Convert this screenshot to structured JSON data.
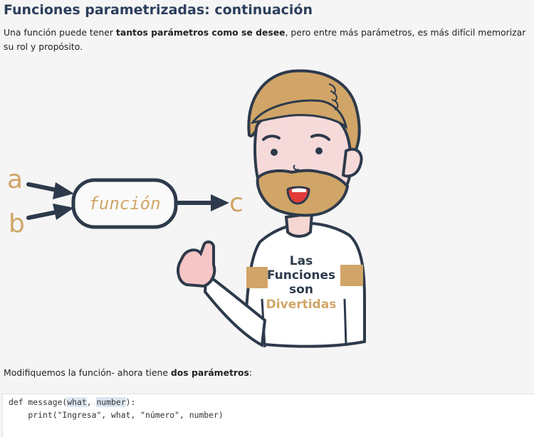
{
  "page_title": "Funciones parametrizadas: continuación",
  "intro": {
    "text1": "Una función puede tener ",
    "bold1": "tantos parámetros como se desee",
    "text2": ", pero entre más parámetros, es más difícil memorizar su rol y propósito."
  },
  "illustration": {
    "input_a": "a",
    "input_b": "b",
    "box_label": "función",
    "output_c": "c",
    "shirt_line1": "Las",
    "shirt_line2": "Funciones",
    "shirt_line3": "son",
    "shirt_line4": "Divertidas"
  },
  "para2": {
    "text1": "Modifiquemos la función- ahora tiene ",
    "bold1": "dos parámetros",
    "text2": ":"
  },
  "code": {
    "l1_a": "def message(",
    "l1_p1": "what",
    "l1_b": ", ",
    "l1_p2": "number",
    "l1_c": "):",
    "l2": "    print(\"Ingresa\", what, \"número\", number)"
  },
  "colors": {
    "accent": "#d1a567",
    "dark": "#2d3a4b",
    "title": "#2c3e5c"
  }
}
